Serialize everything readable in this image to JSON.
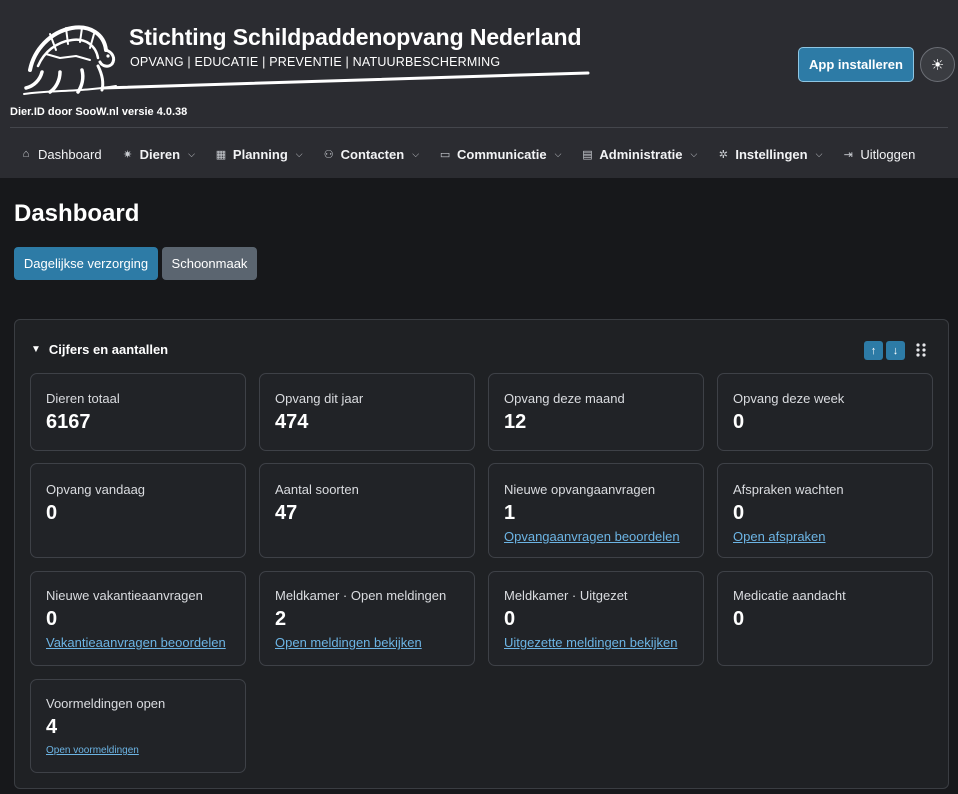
{
  "header": {
    "org_title": "Stichting Schildpaddenopvang Nederland",
    "org_subtitle": "OPVANG | EDUCATIE | PREVENTIE | NATUURBESCHERMING",
    "version": "Dier.ID door SooW.nl versie 4.0.38",
    "install_label": "App installeren",
    "theme_icon": "☀"
  },
  "nav": [
    {
      "label": "Dashboard",
      "icon": "⌂",
      "dropdown": false
    },
    {
      "label": "Dieren",
      "icon": "✷",
      "dropdown": true
    },
    {
      "label": "Planning",
      "icon": "▦",
      "dropdown": true
    },
    {
      "label": "Contacten",
      "icon": "⚇",
      "dropdown": true
    },
    {
      "label": "Communicatie",
      "icon": "▭",
      "dropdown": true
    },
    {
      "label": "Administratie",
      "icon": "▤",
      "dropdown": true
    },
    {
      "label": "Instellingen",
      "icon": "✲",
      "dropdown": true
    },
    {
      "label": "Uitloggen",
      "icon": "⇥",
      "dropdown": false
    }
  ],
  "page": {
    "title": "Dashboard",
    "btn_daily": "Dagelijkse verzorging",
    "btn_clean": "Schoonmaak"
  },
  "panel": {
    "title": "Cijfers en aantallen",
    "sort_up": "↑",
    "sort_down": "↓"
  },
  "cards": [
    {
      "label": "Dieren totaal",
      "value": "6167",
      "link": ""
    },
    {
      "label": "Opvang dit jaar",
      "value": "474",
      "link": ""
    },
    {
      "label": "Opvang deze maand",
      "value": "12",
      "link": ""
    },
    {
      "label": "Opvang deze week",
      "value": "0",
      "link": ""
    },
    {
      "label": "Opvang vandaag",
      "value": "0",
      "link": ""
    },
    {
      "label": "Aantal soorten",
      "value": "47",
      "link": ""
    },
    {
      "label": "Nieuwe opvangaanvragen",
      "value": "1",
      "link": "Opvangaanvragen beoordelen"
    },
    {
      "label": "Afspraken wachten",
      "value": "0",
      "link": "Open afspraken"
    },
    {
      "label": "Nieuwe vakantieaanvragen",
      "value": "0",
      "link": "Vakantieaanvragen beoordelen"
    },
    {
      "label": "Meldkamer · Open meldingen",
      "value": "2",
      "link": "Open meldingen bekijken"
    },
    {
      "label": "Meldkamer · Uitgezet",
      "value": "0",
      "link": "Uitgezette meldingen bekijken"
    },
    {
      "label": "Medicatie aandacht",
      "value": "0",
      "link": ""
    },
    {
      "label": "Voormeldingen open",
      "value": "4",
      "link": "Open voormeldingen"
    }
  ],
  "colors": {
    "accent": "#2d7ba6",
    "link": "#6cb4e4",
    "header_bg": "#2b2c31",
    "page_bg": "#17181b"
  }
}
